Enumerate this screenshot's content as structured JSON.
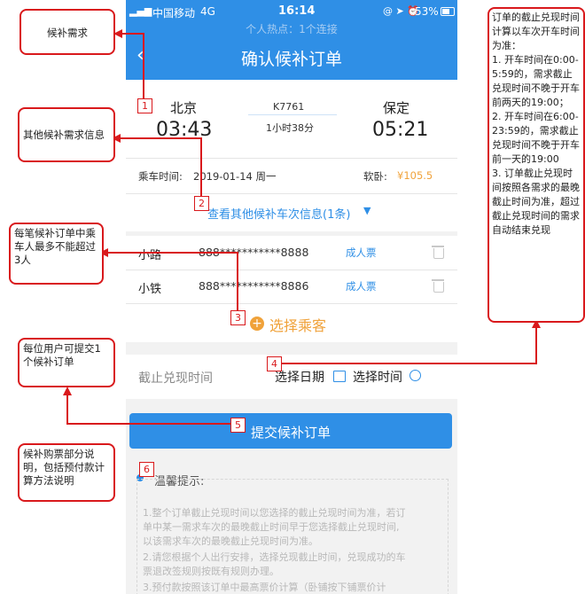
{
  "status": {
    "carrier": "中国移动",
    "network": "4G",
    "time": "16:14",
    "battery": "53%",
    "hotspot": "个人热点：1个连接"
  },
  "nav": {
    "title": "确认候补订单"
  },
  "train": {
    "from_station": "北京",
    "from_time": "03:43",
    "train_no": "K7761",
    "duration": "1小时38分",
    "to_station": "保定",
    "to_time": "05:21"
  },
  "date_row": {
    "label": "乘车时间:",
    "date": "2019-01-14 周一",
    "seat": "软卧:",
    "price": "¥105.5"
  },
  "other_trains": "查看其他候补车次信息(1条)",
  "passengers": [
    {
      "name": "小路",
      "id": "888***********8888",
      "type": "成人票"
    },
    {
      "name": "小铁",
      "id": "888***********8886",
      "type": "成人票"
    }
  ],
  "choose_passenger": "选择乘客",
  "deadline": {
    "label": "截止兑现时间",
    "date_btn": "选择日期",
    "time_btn": "选择时间"
  },
  "submit": "提交候补订单",
  "tips": {
    "title": "温馨提示:",
    "lines": [
      "1.整个订单截止兑现时间以您选择的截止兑现时间为准，若订",
      "单中某一需求车次的最晚截止时间早于您选择截止兑现时间,",
      "以该需求车次的最晚截止兑现时间为准。",
      "2.请您根据个人出行安排，选择兑现截止时间，兑现成功的车",
      "票退改签规则按既有规则办理。",
      "3.预付款按照该订单中最高票价计算（卧铺按下铺票价计"
    ]
  },
  "annotations": {
    "a1": "候补需求",
    "a2": "其他候补需求信息",
    "a3": "每笔候补订单中乘车人最多不能超过3人",
    "a4": "每位用户可提交1个候补订单",
    "a5": "候补购票部分说明，包括预付款计算方法说明",
    "right": "订单的截止兑现时间计算以车次开车时间为准：\n1. 开车时间在0:00-5:59的，需求截止兑现时间不晚于开车前两天的19:00；\n2. 开车时间在6:00-23:59的，需求截止兑现时间不晚于开车前一天的19:00\n3. 订单截止兑现时间按照各需求的最晚截止时间为准，超过截止兑现时间的需求自动结束兑现"
  },
  "markers": [
    "1",
    "2",
    "3",
    "4",
    "5",
    "6"
  ],
  "colors": {
    "primary": "#2f8fe6",
    "orange": "#f0a23a",
    "annotation": "#d9191c"
  }
}
